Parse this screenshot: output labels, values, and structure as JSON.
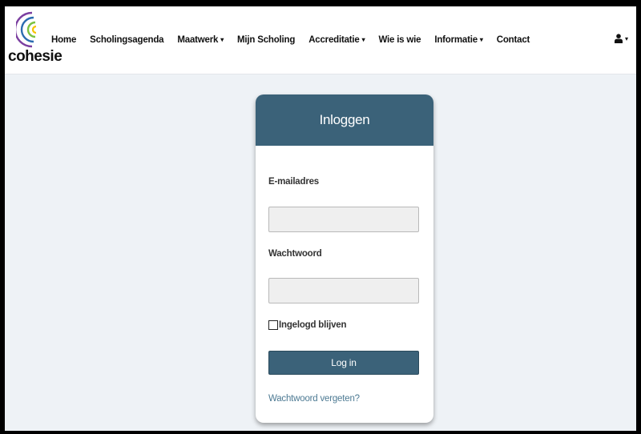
{
  "brand": {
    "logo_text": "cohesie",
    "arc_colors": [
      "#7b3fa0",
      "#2b6cb0",
      "#7cc242",
      "#f5c400"
    ]
  },
  "nav": {
    "home": "Home",
    "scholingsagenda": "Scholingsagenda",
    "maatwerk": "Maatwerk",
    "mijn_scholing": "Mijn Scholing",
    "accreditatie": "Accreditatie",
    "wie_is_wie": "Wie is wie",
    "informatie": "Informatie",
    "contact": "Contact",
    "caret_glyph": "▾",
    "user_icon": "user-icon"
  },
  "login": {
    "title": "Inloggen",
    "email_label": "E-mailadres",
    "email_value": "",
    "password_label": "Wachtwoord",
    "password_value": "",
    "remember_label": "Ingelogd blijven",
    "remember_checked": false,
    "submit_label": "Log in",
    "forgot_label": "Wachtwoord vergeten?"
  },
  "colors": {
    "accent": "#3b6279",
    "page_bg": "#eef2f6",
    "link": "#4d7a93"
  }
}
